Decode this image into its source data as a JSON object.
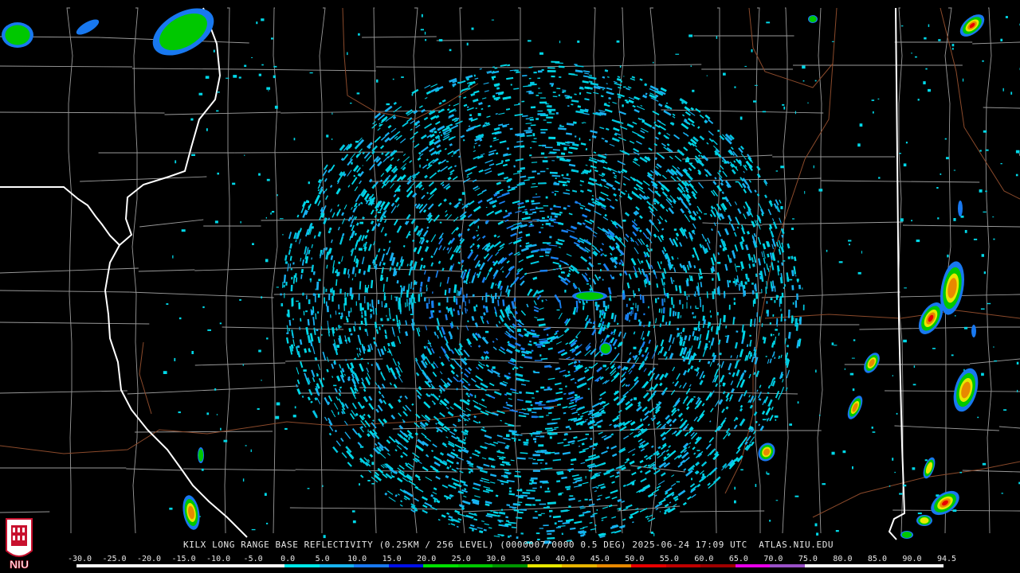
{
  "product_title": "KILX LONG RANGE BASE REFLECTIVITY (0.25KM / 256 LEVEL) (0000007/0000 0.5 DEG) 2025-06-24 17:09 UTC  ATLAS.NIU.EDU",
  "logo": {
    "text": "NIU",
    "color": "#c8102e",
    "icon": "university-seal-icon"
  },
  "scale": {
    "labels": [
      "-30.0",
      "-25.0",
      "-20.0",
      "-15.0",
      "-10.0",
      "-5.0",
      "0.0",
      "5.0",
      "10.0",
      "15.0",
      "20.0",
      "25.0",
      "30.0",
      "35.0",
      "40.0",
      "45.0",
      "50.0",
      "55.0",
      "60.0",
      "65.0",
      "70.0",
      "75.0",
      "80.0",
      "85.0",
      "90.0",
      "94.5"
    ],
    "colors": [
      "#ffffff",
      "#ffffff",
      "#ffffff",
      "#ffffff",
      "#ffffff",
      "#ffffff",
      "#00e8e8",
      "#18b4f0",
      "#1878f0",
      "#0010e8",
      "#00e000",
      "#00c800",
      "#009600",
      "#e8e800",
      "#e8b400",
      "#e88800",
      "#e80000",
      "#c00000",
      "#a00000",
      "#e800e8",
      "#9a50c8",
      "#ffffff",
      "#ffffff",
      "#ffffff",
      "#ffffff"
    ]
  },
  "colors": {
    "background": "#000000",
    "county_lines": "#9a9a9a",
    "state_lines": "#ffffff",
    "rivers": "#8b4a2b",
    "echo_light": "#00d8e8",
    "echo_mid": "#1880f0"
  }
}
